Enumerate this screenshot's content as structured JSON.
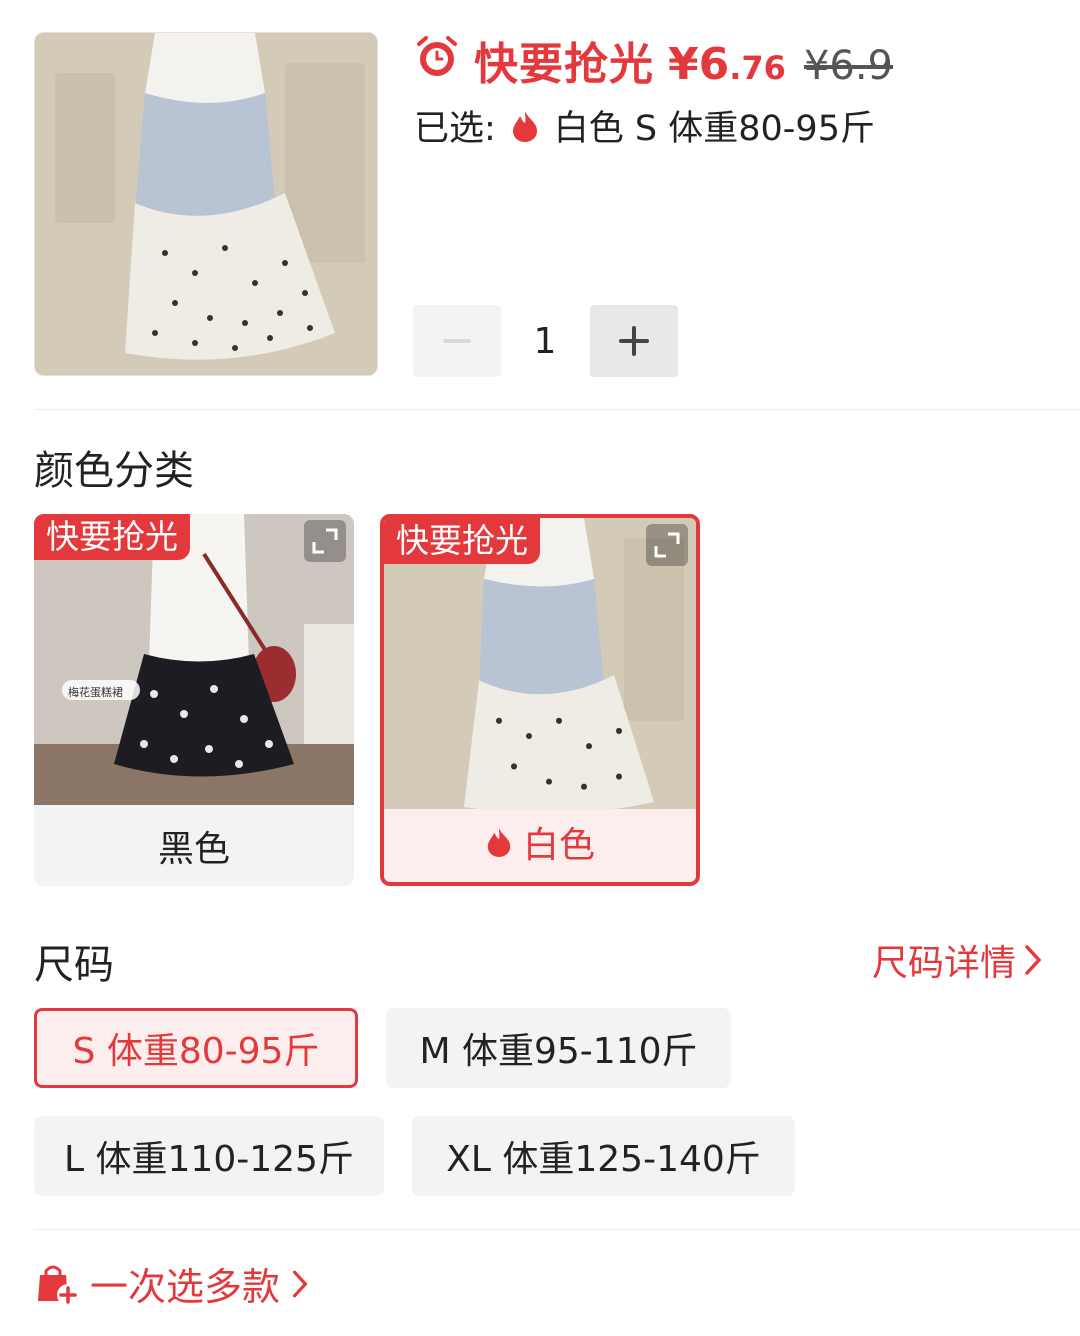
{
  "header": {
    "flash_label": "快要抢光",
    "price_symbol": "¥",
    "price_int": "6",
    "price_dec": ".76",
    "original_price": "¥6.9",
    "selected_prefix": "已选:",
    "selected_value": "白色 S 体重80-95斤"
  },
  "quantity": {
    "value": "1"
  },
  "color_section": {
    "title": "颜色分类",
    "options": [
      {
        "label": "黑色",
        "tag": "快要抢光",
        "selected": false,
        "img_caption": "梅花蛋糕裙"
      },
      {
        "label": "白色",
        "tag": "快要抢光",
        "selected": true
      }
    ]
  },
  "size_section": {
    "title": "尺码",
    "detail_link": "尺码详情",
    "options": [
      {
        "label": "S 体重80-95斤",
        "selected": true
      },
      {
        "label": "M 体重95-110斤",
        "selected": false
      },
      {
        "label": "L 体重110-125斤",
        "selected": false
      },
      {
        "label": "XL 体重125-140斤",
        "selected": false
      }
    ]
  },
  "footer": {
    "multi_select": "一次选多款"
  },
  "colors": {
    "accent": "#e4393c",
    "chip_bg": "#f3f3f3",
    "selected_bg": "#fdeeee"
  },
  "icons": [
    "alarm-icon",
    "flame-icon",
    "expand-icon",
    "chevron-right-icon",
    "bag-plus-icon",
    "minus-icon",
    "plus-icon"
  ]
}
